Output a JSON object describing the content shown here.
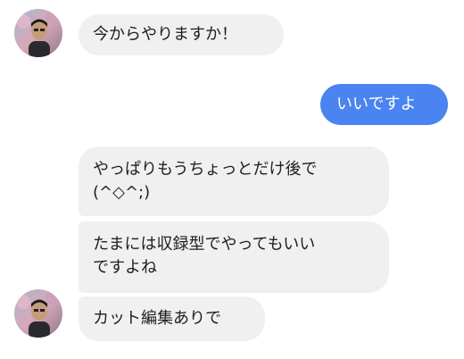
{
  "conversation": {
    "messages": [
      {
        "sender": "friend",
        "text": "今からやりますか！"
      },
      {
        "sender": "me",
        "text": "いいですよ"
      },
      {
        "sender": "friend",
        "text": "やっぱりもうちょっとだけ後で\n(^◇^;)"
      },
      {
        "sender": "friend",
        "text": "たまには収録型でやってもいい\nですよね"
      },
      {
        "sender": "friend",
        "text": "カット編集ありで"
      }
    ]
  },
  "colors": {
    "incoming_bubble": "#f0f0f0",
    "outgoing_bubble": "#4a84f0",
    "text": "#1c1e21",
    "outgoing_text": "#ffffff"
  }
}
